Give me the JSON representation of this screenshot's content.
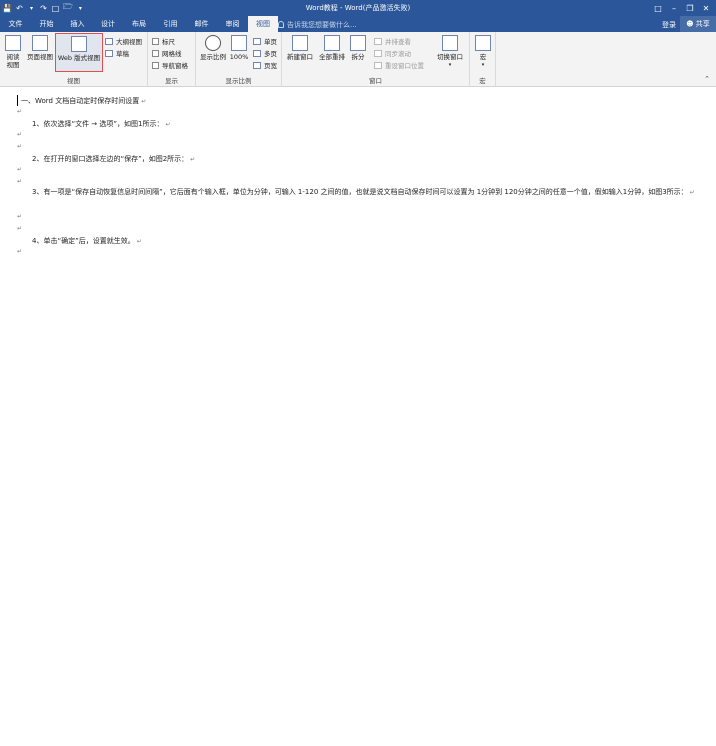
{
  "window": {
    "title": "Word教程 - Word(产品激活失败)"
  },
  "qat": {
    "save_icon": "save-icon",
    "undo_icon": "undo-icon",
    "redo_icon": "redo-icon",
    "new_icon": "new-document-icon",
    "open_icon": "open-icon",
    "customize_icon": "customize-icon"
  },
  "tabs": [
    "文件",
    "开始",
    "插入",
    "设计",
    "布局",
    "引用",
    "邮件",
    "审阅",
    "视图"
  ],
  "active_tab": "视图",
  "tell_me": "告诉我您想要做什么...",
  "account": {
    "signin": "登录",
    "share": "共享"
  },
  "ribbon": {
    "views": {
      "label": "视图",
      "read_mode": "阅读\n视图",
      "print_layout": "页面视图",
      "web_layout": "Web 版式视图",
      "outline": "大纲视图",
      "draft": "草稿"
    },
    "show": {
      "label": "显示",
      "ruler": "标尺",
      "gridlines": "网格线",
      "nav_pane": "导航窗格"
    },
    "zoom": {
      "label": "显示比例",
      "zoom": "显示比例",
      "hundred": "100%",
      "one_page": "单页",
      "multi_page": "多页",
      "page_width": "页宽"
    },
    "window": {
      "label": "窗口",
      "new_window": "新建窗口",
      "arrange_all": "全部重排",
      "split": "拆分",
      "side_by_side": "并排查看",
      "sync_scroll": "同步滚动",
      "reset_pos": "重设窗口位置",
      "switch": "切换窗口"
    },
    "macros": {
      "label": "宏",
      "macros": "宏"
    }
  },
  "document": {
    "heading": "一、Word 文档自动定时保存时间设置",
    "step1": "1、依次选择“文件 → 选项”，如图1所示：",
    "step2": "2、在打开的窗口选择左边的“保存”，如图2所示：",
    "step3": "3、有一项是“保存自动恢复信息时间间隔”，它后面有个输入框，单位为分钟，可输入 1-120 之间的值，也就是说文档自动保存时间可以设置为 1分钟到 120分钟之间的任意一个值，假如输入1分钟，如图3所示：",
    "step4": "4、单击“确定”后，设置就生效。",
    "mark": "↵"
  }
}
